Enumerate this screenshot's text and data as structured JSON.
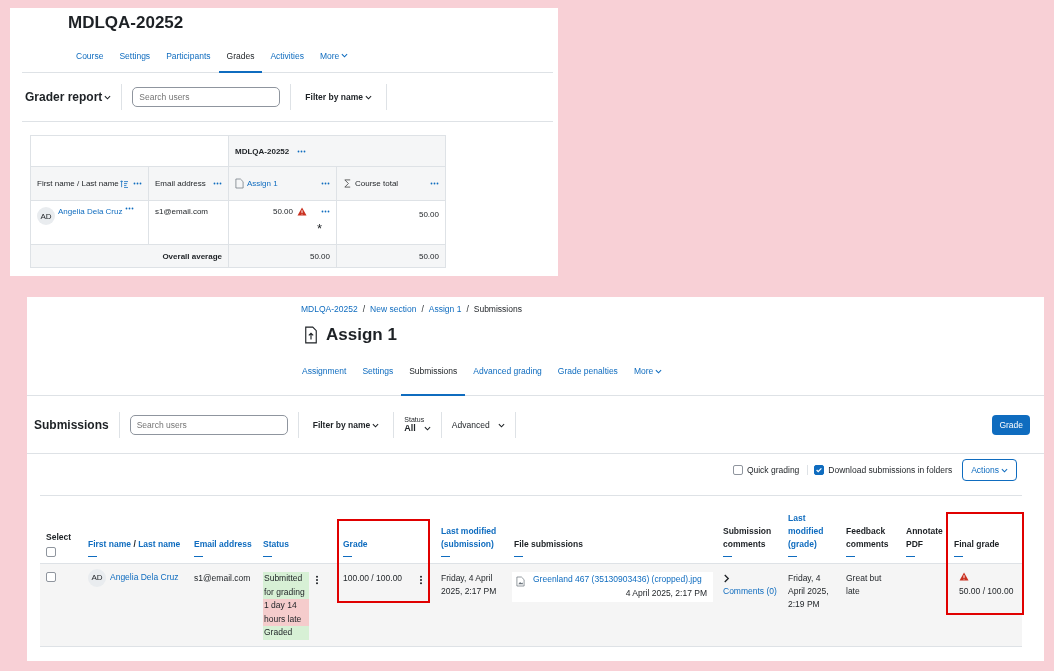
{
  "grader": {
    "course_title": "MDLQA-20252",
    "tabs": [
      {
        "label": "Course",
        "selected": false
      },
      {
        "label": "Settings",
        "selected": false
      },
      {
        "label": "Participants",
        "selected": false
      },
      {
        "label": "Grades",
        "selected": true
      },
      {
        "label": "Activities",
        "selected": false
      },
      {
        "label": "More",
        "selected": false
      }
    ],
    "report_menu": "Grader report",
    "search": {
      "placeholder": "Search users"
    },
    "filter": "Filter by name",
    "table": {
      "category": "MDLQA-20252",
      "name_column": "First name / Last name",
      "email_column": "Email address",
      "item_column": "Assign 1",
      "total_column": "Course total",
      "rows": [
        {
          "initials": "AD",
          "name": "Angelia Dela Cruz",
          "email": "s1@email.com",
          "item_grade": "50.00",
          "mark": "*",
          "total": "50.00"
        }
      ],
      "average": {
        "label": "Overall average",
        "item_grade": "50.00",
        "total": "50.00"
      }
    }
  },
  "submissions": {
    "breadcrumb": [
      "MDLQA-20252",
      "New section",
      "Assign 1",
      "Submissions"
    ],
    "breadcrumb_separator": "/",
    "title": "Assign 1",
    "tabs": [
      {
        "label": "Assignment",
        "selected": false
      },
      {
        "label": "Settings",
        "selected": false
      },
      {
        "label": "Submissions",
        "selected": true
      },
      {
        "label": "Advanced grading",
        "selected": false
      },
      {
        "label": "Grade penalties",
        "selected": false
      },
      {
        "label": "More",
        "selected": false
      }
    ],
    "heading": "Submissions",
    "search": {
      "placeholder": "Search users"
    },
    "filter": "Filter by name",
    "status_filter": {
      "label": "Status",
      "value": "All"
    },
    "advanced": "Advanced",
    "grade_button": "Grade",
    "options": [
      {
        "label": "Quick grading",
        "checked": false
      },
      {
        "label": "Download submissions in folders",
        "checked": true
      }
    ],
    "actions": "Actions",
    "columns": [
      {
        "label": "Select",
        "linked": false
      },
      {
        "label": "First name",
        "label_2": "Last name",
        "separator": "/",
        "linked": true
      },
      {
        "label": "Email address",
        "linked": true
      },
      {
        "label": "Status",
        "linked": true
      },
      {
        "label": "Grade",
        "linked": true
      },
      {
        "label": "Last modified (submission)",
        "linked": true
      },
      {
        "label": "File submissions",
        "linked": false
      },
      {
        "label": "Submission comments",
        "linked": false
      },
      {
        "label": "Last modified (grade)",
        "linked": true
      },
      {
        "label": "Feedback comments",
        "linked": false
      },
      {
        "label": "Annotate PDF",
        "linked": false
      },
      {
        "label": "Final grade",
        "linked": false
      }
    ],
    "select_all": {
      "checked": false
    },
    "rows": [
      {
        "checked": false,
        "initials": "AD",
        "name": "Angelia Dela Cruz",
        "email": "s1@email.com",
        "status": [
          {
            "text": "Submitted for grading",
            "kind": "success"
          },
          {
            "text": "1 day 14 hours late",
            "kind": "danger"
          },
          {
            "text": "Graded",
            "kind": "success"
          }
        ],
        "grade": "100.00 / 100.00",
        "last_modified": "Friday, 4 April 2025, 2:17 PM",
        "file": {
          "name": "Greenland 467 (35130903436) (cropped).jpg",
          "date": "4 April 2025, 2:17 PM"
        },
        "comments": "Comments (0)",
        "grade_modified": "Friday, 4 April 2025, 2:19 PM",
        "feedback": "Great but late",
        "final_grade": "50.00 / 100.00"
      }
    ]
  }
}
